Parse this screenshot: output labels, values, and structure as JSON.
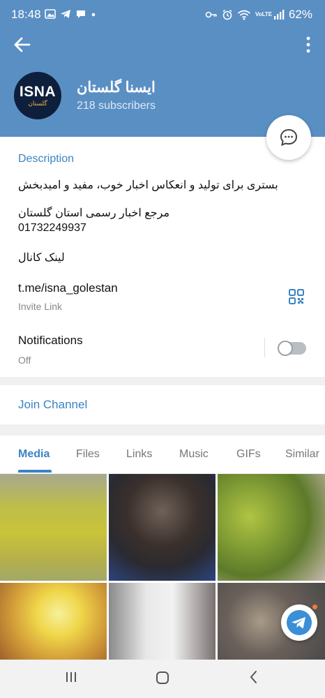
{
  "status_bar": {
    "time": "18:48",
    "left_icons": [
      "image-icon",
      "telegram-icon",
      "chat-icon",
      "dot-icon"
    ],
    "right_icons": [
      "key-icon",
      "alarm-icon",
      "wifi-icon",
      "volte-icon",
      "signal-icon"
    ],
    "volte_text": "VoLTE",
    "battery": "62%"
  },
  "header": {
    "channel_name": "ایسنا گلستان",
    "subscribers": "218 subscribers",
    "avatar_text": "ISNA",
    "avatar_subtext": "گلستان"
  },
  "description": {
    "title": "Description",
    "line1": "بستری برای تولید و انعکاس اخبار خوب، مفید و امیدبخش",
    "line2": "مرجع اخبار رسمی استان گلستان",
    "line3": "01732249937",
    "line4": "لینک کانال"
  },
  "invite": {
    "link": "t.me/isna_golestan",
    "label": "Invite Link"
  },
  "notifications": {
    "title": "Notifications",
    "state": "Off",
    "enabled": false
  },
  "join": {
    "label": "Join Channel"
  },
  "tabs": [
    "Media",
    "Files",
    "Links",
    "Music",
    "GIFs",
    "Similar"
  ],
  "active_tab": "Media",
  "colors": {
    "header": "#5a8fc4",
    "accent": "#3a84c4",
    "avatar_bg": "#0e1f3c",
    "avatar_accent": "#f2b13a"
  }
}
